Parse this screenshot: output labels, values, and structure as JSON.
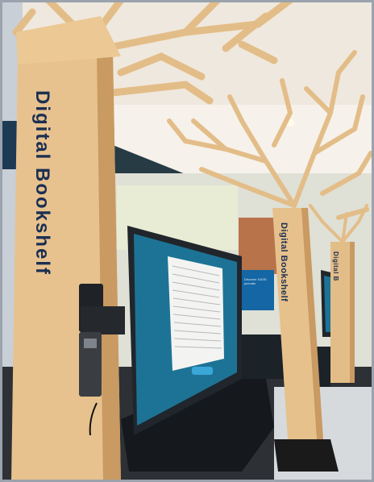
{
  "photo": {
    "pillar_main_label": "Digital Bookshelf",
    "pillar_mid_label": "Digital Bookshelf",
    "pillar_far_label": "Digital B",
    "banner_text": "Discover SAGE journals",
    "colors": {
      "wood": "#e3bd88",
      "wood_shadow": "#c99a61",
      "screen": "#1a6f92",
      "ceiling": "#f1ebe2",
      "floor": "#2b2f33",
      "lettering": "#1c2f52"
    }
  }
}
